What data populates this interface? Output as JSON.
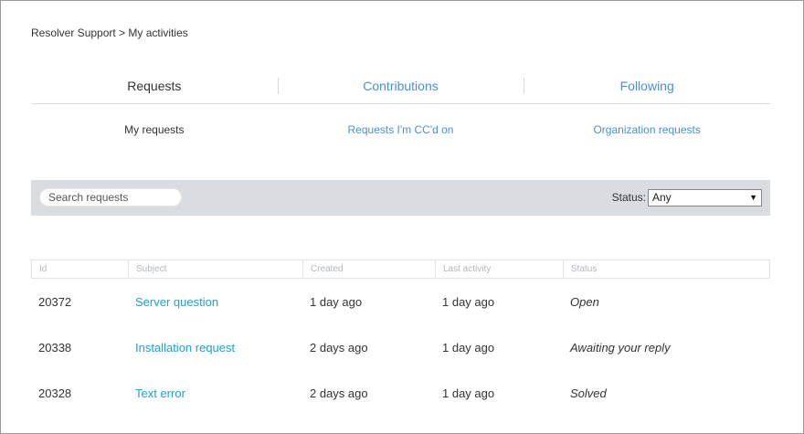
{
  "breadcrumb": {
    "home": "Resolver Support",
    "separator": ">",
    "current": "My activities"
  },
  "main_tabs": [
    {
      "label": "Requests"
    },
    {
      "label": "Contributions"
    },
    {
      "label": "Following"
    }
  ],
  "sub_tabs": [
    {
      "label": "My requests"
    },
    {
      "label": "Requests I'm CC'd on"
    },
    {
      "label": "Organization requests"
    }
  ],
  "filters": {
    "search_placeholder": "Search requests",
    "status_label": "Status:",
    "status_value": "Any"
  },
  "table": {
    "headers": [
      "Id",
      "Subject",
      "Created",
      "Last activity",
      "Status"
    ],
    "rows": [
      {
        "id": "20372",
        "subject": "Server question",
        "created": "1 day ago",
        "last_activity": "1 day ago",
        "status": "Open"
      },
      {
        "id": "20338",
        "subject": "Installation request",
        "created": "2 days ago",
        "last_activity": "1 day ago",
        "status": "Awaiting your reply"
      },
      {
        "id": "20328",
        "subject": "Text error",
        "created": "2 days ago",
        "last_activity": "1 day ago",
        "status": "Solved"
      }
    ]
  },
  "colors": {
    "link": "#4a90d9",
    "subject_link": "#1aa3d6",
    "filter_bar": "#d9dde0"
  }
}
